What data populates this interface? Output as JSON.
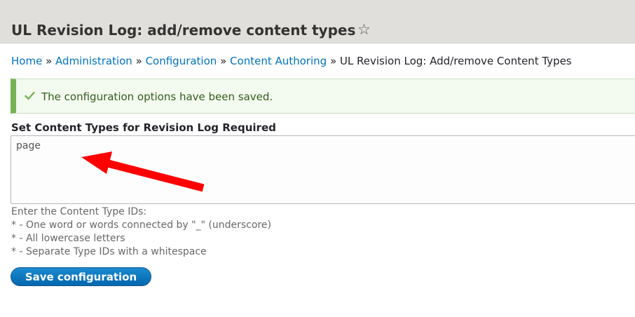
{
  "header": {
    "title": "UL Revision Log: add/remove content types",
    "star_icon": "star-outline-icon"
  },
  "breadcrumb": {
    "items": [
      {
        "label": "Home"
      },
      {
        "label": "Administration"
      },
      {
        "label": "Configuration"
      },
      {
        "label": "Content Authoring"
      }
    ],
    "separator": "»",
    "current": "UL Revision Log: Add/remove Content Types"
  },
  "status": {
    "icon": "checkmark-icon",
    "message": "The configuration options have been saved.",
    "color": "#77b259"
  },
  "form": {
    "label": "Set Content Types for Revision Log Required",
    "value": "page",
    "description": [
      "Enter the Content Type IDs:",
      "* - One word or words connected by \"_\" (underscore)",
      "* - All lowercase letters",
      "* - Separate Type IDs with a whitespace"
    ],
    "submit_label": "Save configuration"
  },
  "annotation": {
    "icon": "red-arrow-icon",
    "color": "#ff0000"
  }
}
